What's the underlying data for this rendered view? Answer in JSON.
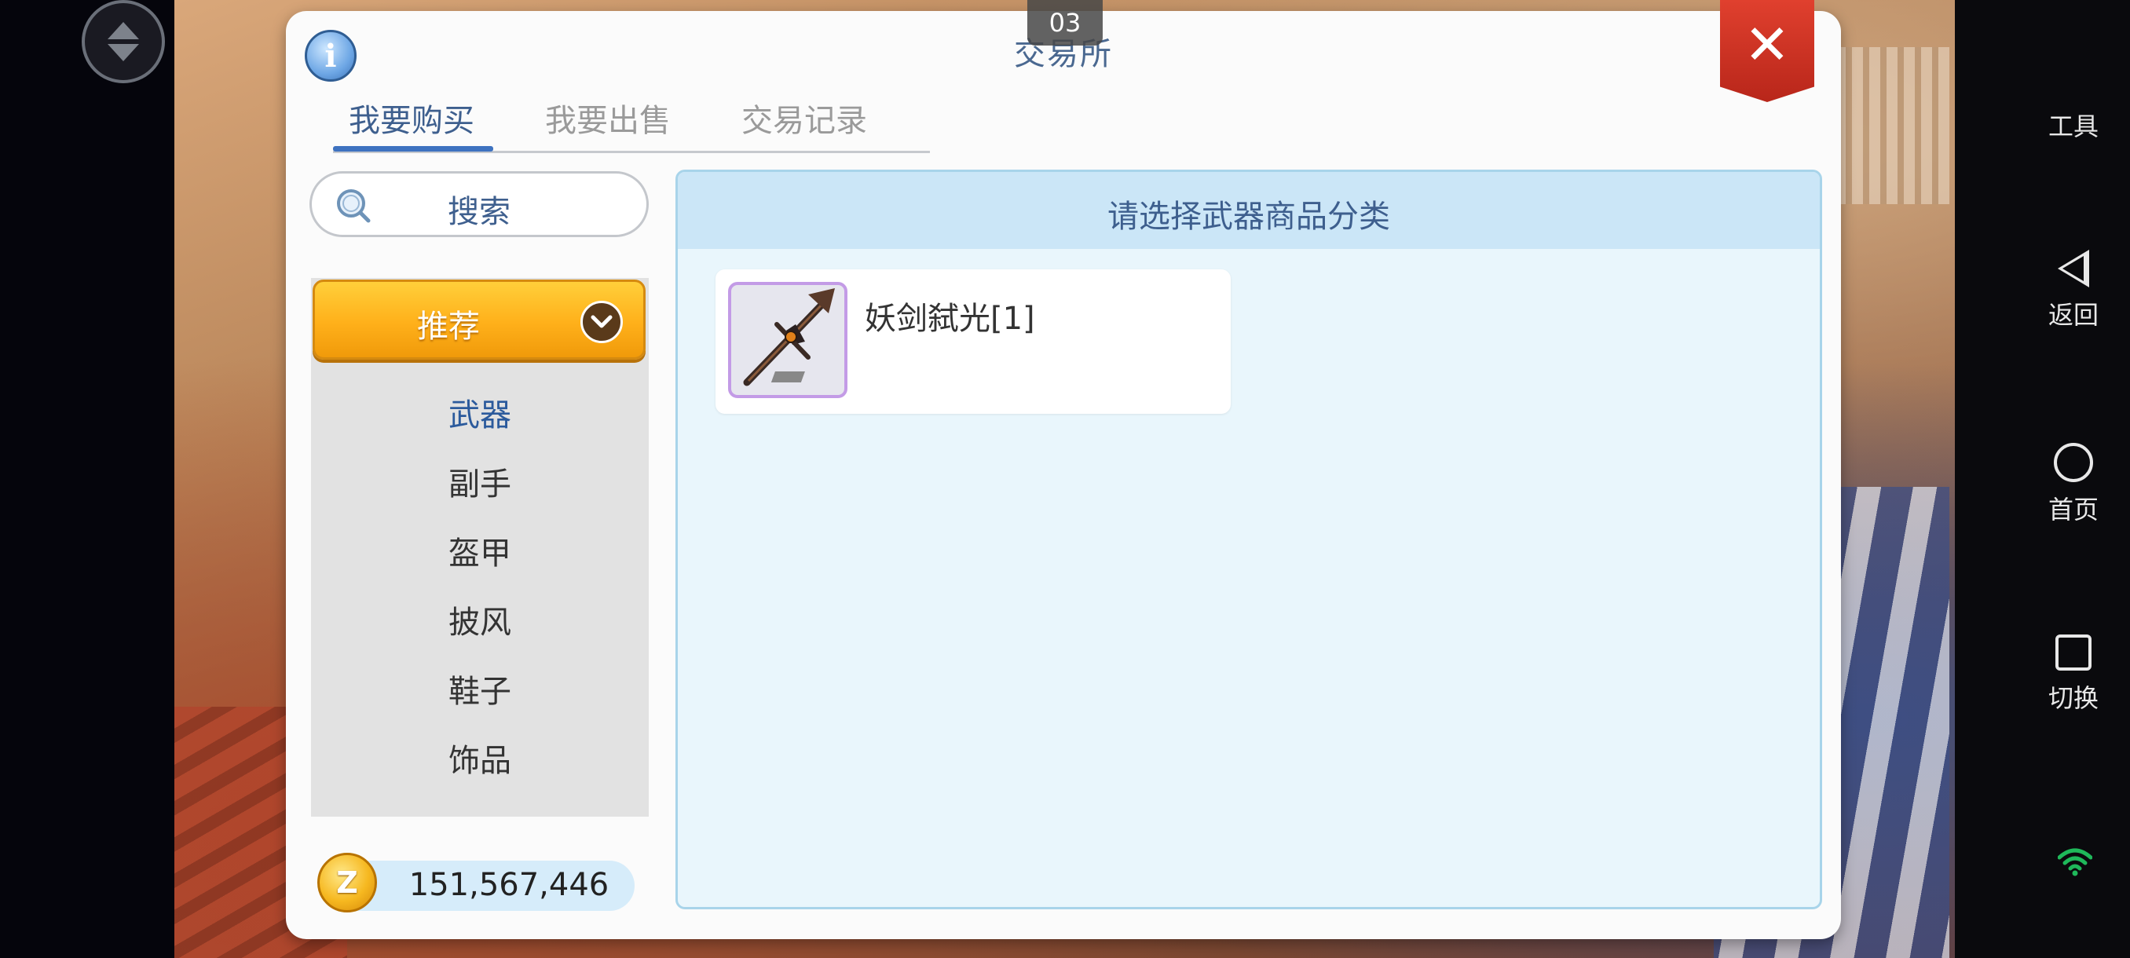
{
  "status": {
    "time": "03"
  },
  "dialog": {
    "title": "交易所",
    "info_icon": "i",
    "close_icon": "✕",
    "tabs": [
      {
        "label": "我要购买",
        "active": true
      },
      {
        "label": "我要出售",
        "active": false
      },
      {
        "label": "交易记录",
        "active": false
      }
    ],
    "search": {
      "label": "搜索"
    },
    "category_dropdown": {
      "label": "推荐"
    },
    "categories": [
      {
        "label": "武器",
        "active": true
      },
      {
        "label": "副手",
        "active": false
      },
      {
        "label": "盔甲",
        "active": false
      },
      {
        "label": "披风",
        "active": false
      },
      {
        "label": "鞋子",
        "active": false
      },
      {
        "label": "饰品",
        "active": false
      }
    ],
    "currency": {
      "symbol": "Z",
      "amount": "151,567,446"
    },
    "content": {
      "header": "请选择武器商品分类",
      "items": [
        {
          "name": "妖剑弑光[1]"
        }
      ]
    }
  },
  "system_bar": {
    "items": [
      {
        "label": "工具",
        "icon": "grid-icon"
      },
      {
        "label": "返回",
        "icon": "back-icon"
      },
      {
        "label": "首页",
        "icon": "home-icon"
      },
      {
        "label": "切换",
        "icon": "switch-icon"
      }
    ]
  },
  "colors": {
    "accent_blue": "#3e5f8e",
    "tab_active_underline": "#3e72c0",
    "dropdown_orange": "#ffb01a",
    "close_red": "#c8301f",
    "wifi_green": "#1fb85a"
  }
}
